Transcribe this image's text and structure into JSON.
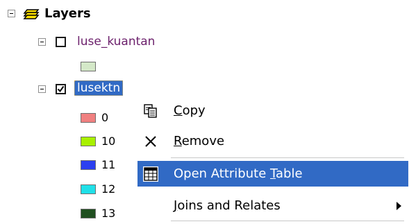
{
  "toc": {
    "title": "Layers",
    "layers": [
      {
        "name": "luse_kuantan",
        "checked": false,
        "swatch_color": "#d4e8c8"
      },
      {
        "name": "lusektn",
        "checked": true,
        "selected": true,
        "classes": [
          {
            "label": "0",
            "color": "#f08080"
          },
          {
            "label": "10",
            "color": "#a8f000"
          },
          {
            "label": "11",
            "color": "#2b3ff0"
          },
          {
            "label": "12",
            "color": "#20e0e8"
          },
          {
            "label": "13",
            "color": "#1f4f1f"
          }
        ]
      }
    ]
  },
  "context_menu": {
    "copy": {
      "pre": "",
      "accel": "C",
      "post": "opy",
      "icon": "copy-icon"
    },
    "remove": {
      "pre": "",
      "accel": "R",
      "post": "emove",
      "icon": "remove-icon"
    },
    "open_attr": {
      "pre": "Open Attribute ",
      "accel": "T",
      "post": "able",
      "icon": "table-icon"
    },
    "joins": {
      "pre": "",
      "accel": "J",
      "post": "oins and Relates",
      "icon": "submenu-arrow-icon"
    }
  }
}
